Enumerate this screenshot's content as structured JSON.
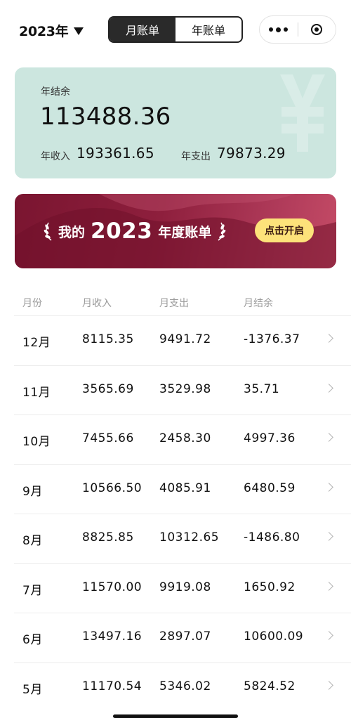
{
  "header": {
    "year": "2023年",
    "tabs": [
      {
        "label": "月账单",
        "active": true
      },
      {
        "label": "年账单",
        "active": false
      }
    ],
    "icons": [
      "more-icon",
      "close-target-icon"
    ]
  },
  "summary": {
    "balance_label": "年结余",
    "balance": "113488.36",
    "income_label": "年收入",
    "income": "193361.65",
    "expense_label": "年支出",
    "expense": "79873.29",
    "watermark_icon": "yen-icon",
    "bg_color": "#cce6df"
  },
  "banner": {
    "prefix": "我的",
    "year": "2023",
    "suffix": "年度账单",
    "button": "点击开启",
    "button_color": "#fde27a",
    "bg_color": "#8e1f3d"
  },
  "table": {
    "headers": [
      "月份",
      "月收入",
      "月支出",
      "月结余"
    ],
    "rows": [
      {
        "month": "12月",
        "income": "8115.35",
        "expense": "9491.72",
        "balance": "-1376.37"
      },
      {
        "month": "11月",
        "income": "3565.69",
        "expense": "3529.98",
        "balance": "35.71"
      },
      {
        "month": "10月",
        "income": "7455.66",
        "expense": "2458.30",
        "balance": "4997.36"
      },
      {
        "month": "9月",
        "income": "10566.50",
        "expense": "4085.91",
        "balance": "6480.59"
      },
      {
        "month": "8月",
        "income": "8825.85",
        "expense": "10312.65",
        "balance": "-1486.80"
      },
      {
        "month": "7月",
        "income": "11570.00",
        "expense": "9919.08",
        "balance": "1650.92"
      },
      {
        "month": "6月",
        "income": "13497.16",
        "expense": "2897.07",
        "balance": "10600.09"
      },
      {
        "month": "5月",
        "income": "11170.54",
        "expense": "5346.02",
        "balance": "5824.52"
      }
    ]
  }
}
